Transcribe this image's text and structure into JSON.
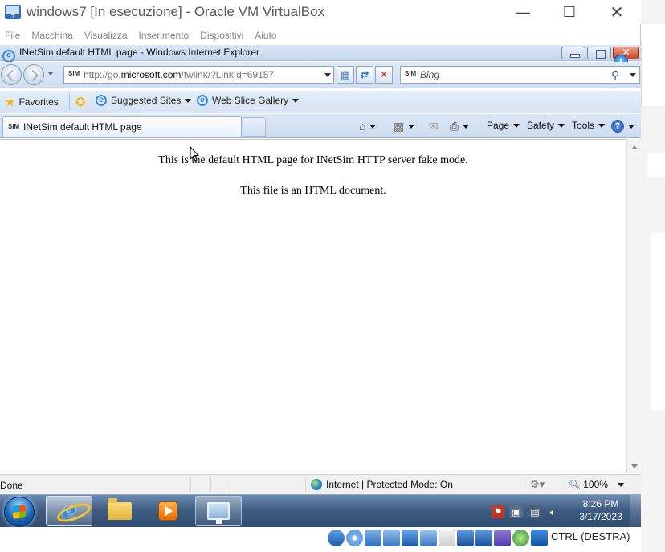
{
  "vbox": {
    "title": "windows7 [In esecuzione] - Oracle VM VirtualBox",
    "menu": [
      "File",
      "Macchina",
      "Visualizza",
      "Inserimento",
      "Dispositivi",
      "Aiuto"
    ],
    "host_key": "CTRL (DESTRA)"
  },
  "ie": {
    "title": "INetSim default HTML page - Windows Internet Explorer",
    "address_prefix": "http://go.",
    "address_domain": "microsoft.com",
    "address_path": "/fwlink/?LinkId=69157",
    "search_provider": "SIM",
    "search_placeholder": "Bing",
    "favorites_label": "Favorites",
    "suggested_sites": "Suggested Sites",
    "web_slice_gallery": "Web Slice Gallery",
    "tab_label": "INetSim default HTML page",
    "tab_favicon": "SIM",
    "cmd_page": "Page",
    "cmd_safety": "Safety",
    "cmd_tools": "Tools",
    "notify_badge": "!"
  },
  "page": {
    "line1": "This is the default HTML page for INetSim HTTP server fake mode.",
    "line2": "This file is an HTML document."
  },
  "status": {
    "text": "Done",
    "zone": "Internet | Protected Mode: On",
    "zoom": "100%"
  },
  "taskbar": {
    "time": "8:26 PM",
    "date": "3/17/2023"
  },
  "colors": {
    "ie_chrome": "#d9e6f5",
    "taskbar": "#3f5d83",
    "close_button": "#c7442a"
  }
}
